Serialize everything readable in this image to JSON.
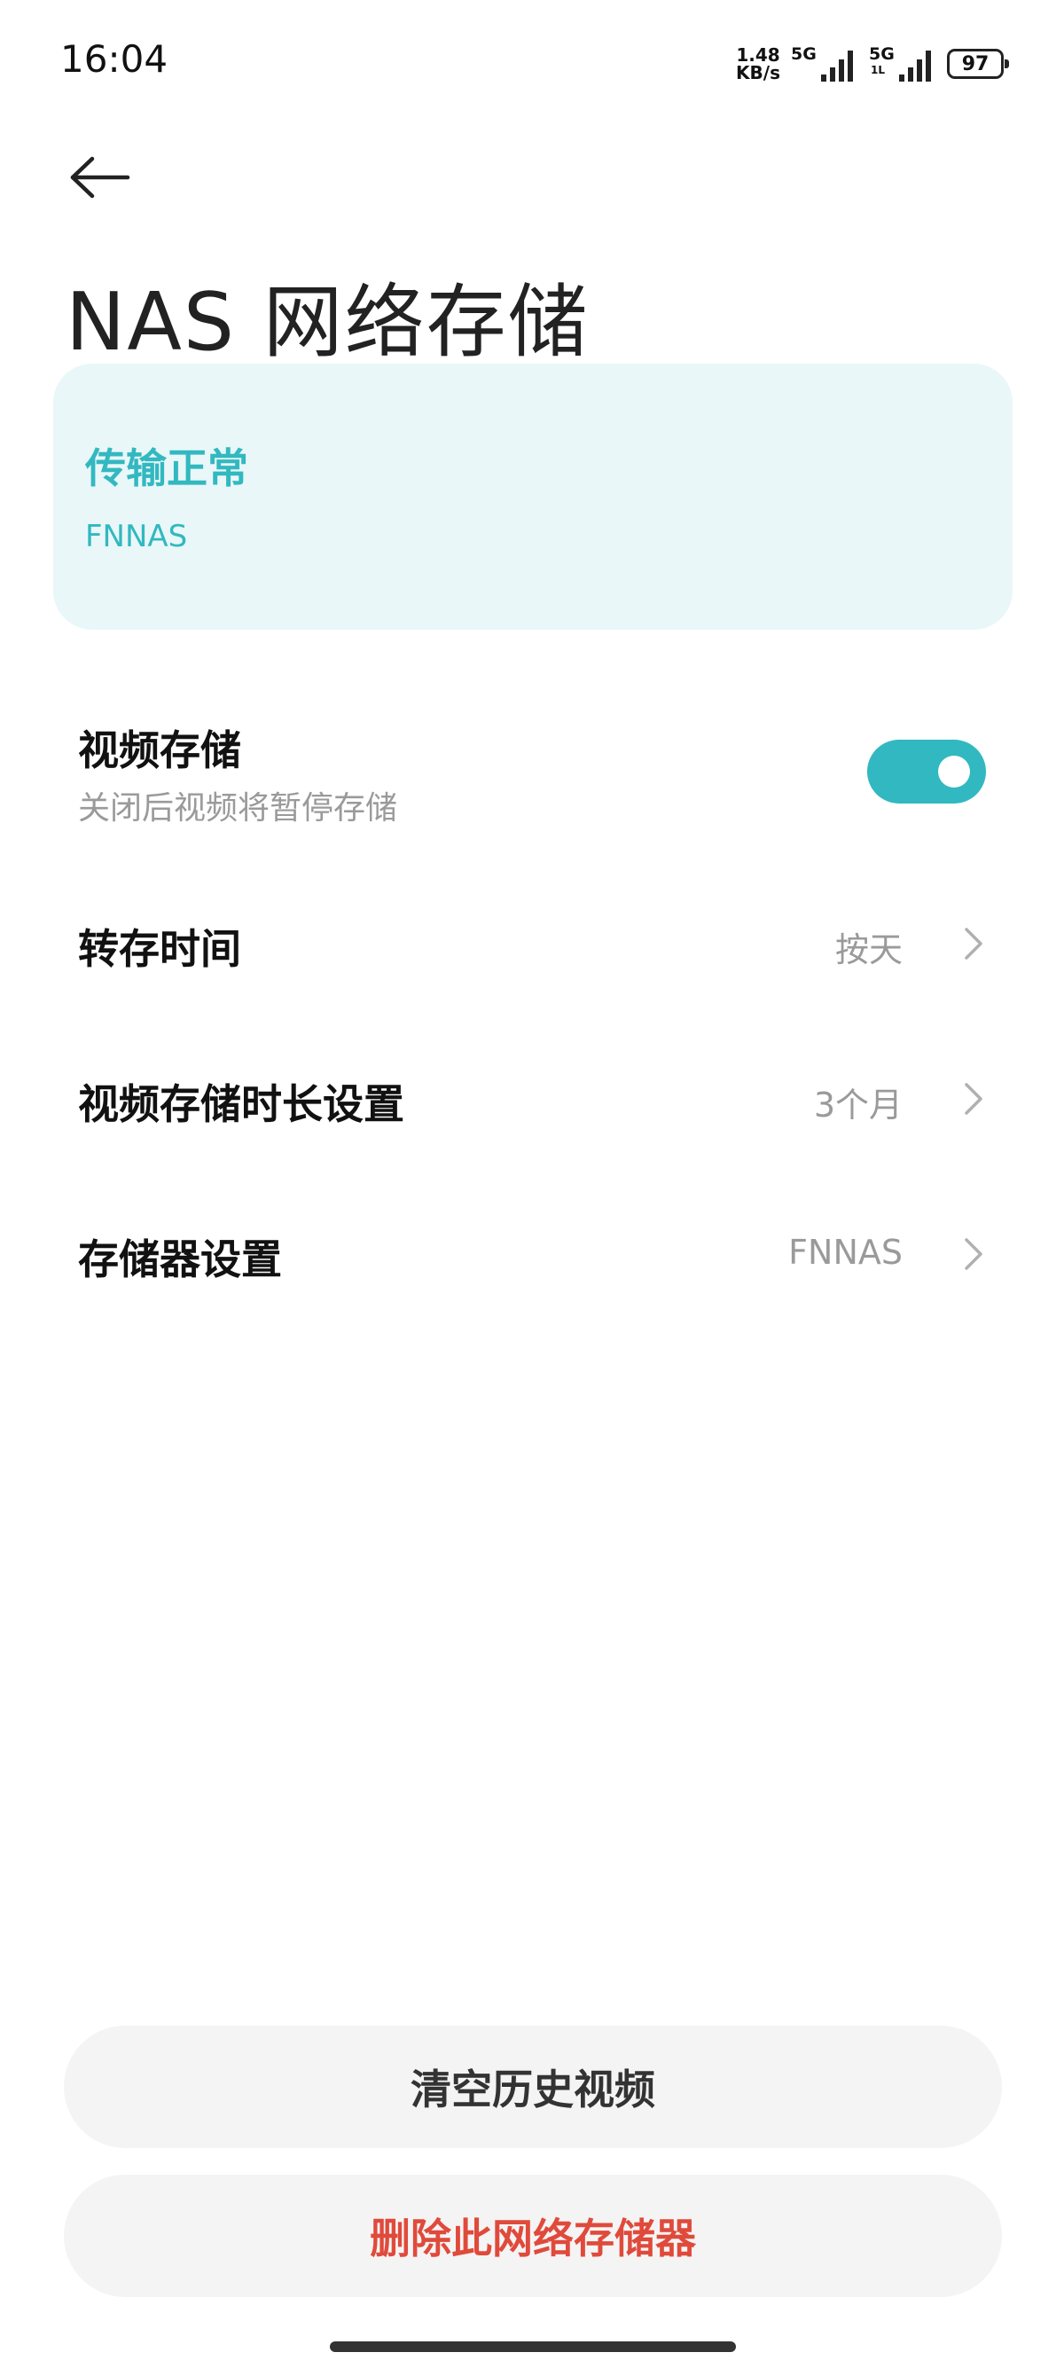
{
  "status_bar": {
    "time": "16:04",
    "net_speed_value": "1.48",
    "net_speed_unit": "KB/s",
    "sim1_gen": "5G",
    "sim2_gen": "5G",
    "sim2_sub": "1L",
    "battery": "97"
  },
  "header": {
    "title": "NAS 网络存储"
  },
  "status_card": {
    "state": "传输正常",
    "device": "FNNAS",
    "background_color": "#e9f7f8",
    "accent_color": "#32b8c0"
  },
  "settings": {
    "video_storage": {
      "label": "视频存储",
      "description": "关闭后视频将暂停存储",
      "enabled": true
    },
    "transfer_time": {
      "label": "转存时间",
      "value": "按天"
    },
    "retention": {
      "label": "视频存储时长设置",
      "value": "3个月"
    },
    "storage_device": {
      "label": "存储器设置",
      "value": "FNNAS"
    }
  },
  "actions": {
    "clear_history_label": "清空历史视频",
    "delete_storage_label": "删除此网络存储器",
    "delete_color": "#e04a3b"
  }
}
